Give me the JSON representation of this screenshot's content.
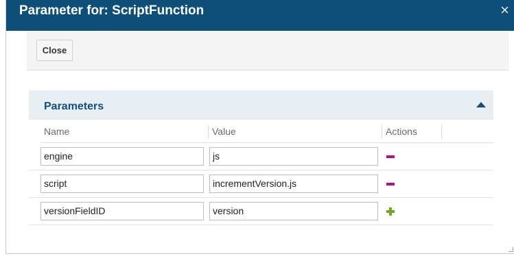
{
  "dialog": {
    "title": "Parameter for: ScriptFunction",
    "close_icon": "×"
  },
  "toolbar": {
    "close_label": "Close"
  },
  "panel": {
    "title": "Parameters",
    "collapse_icon": "triangle-up-icon",
    "columns": [
      "Name",
      "Value",
      "Actions"
    ],
    "rows": [
      {
        "name": "engine",
        "value": "js",
        "action": "remove"
      },
      {
        "name": "script",
        "value": "incrementVersion.js",
        "action": "remove"
      },
      {
        "name": "versionFieldID",
        "value": "version",
        "action": "add"
      }
    ]
  },
  "colors": {
    "title_bar": "#0d4f76",
    "panel_header_bg": "#e9eef3",
    "panel_title": "#11507a",
    "remove_action": "#b5127d",
    "add_action": "#6fa825"
  }
}
